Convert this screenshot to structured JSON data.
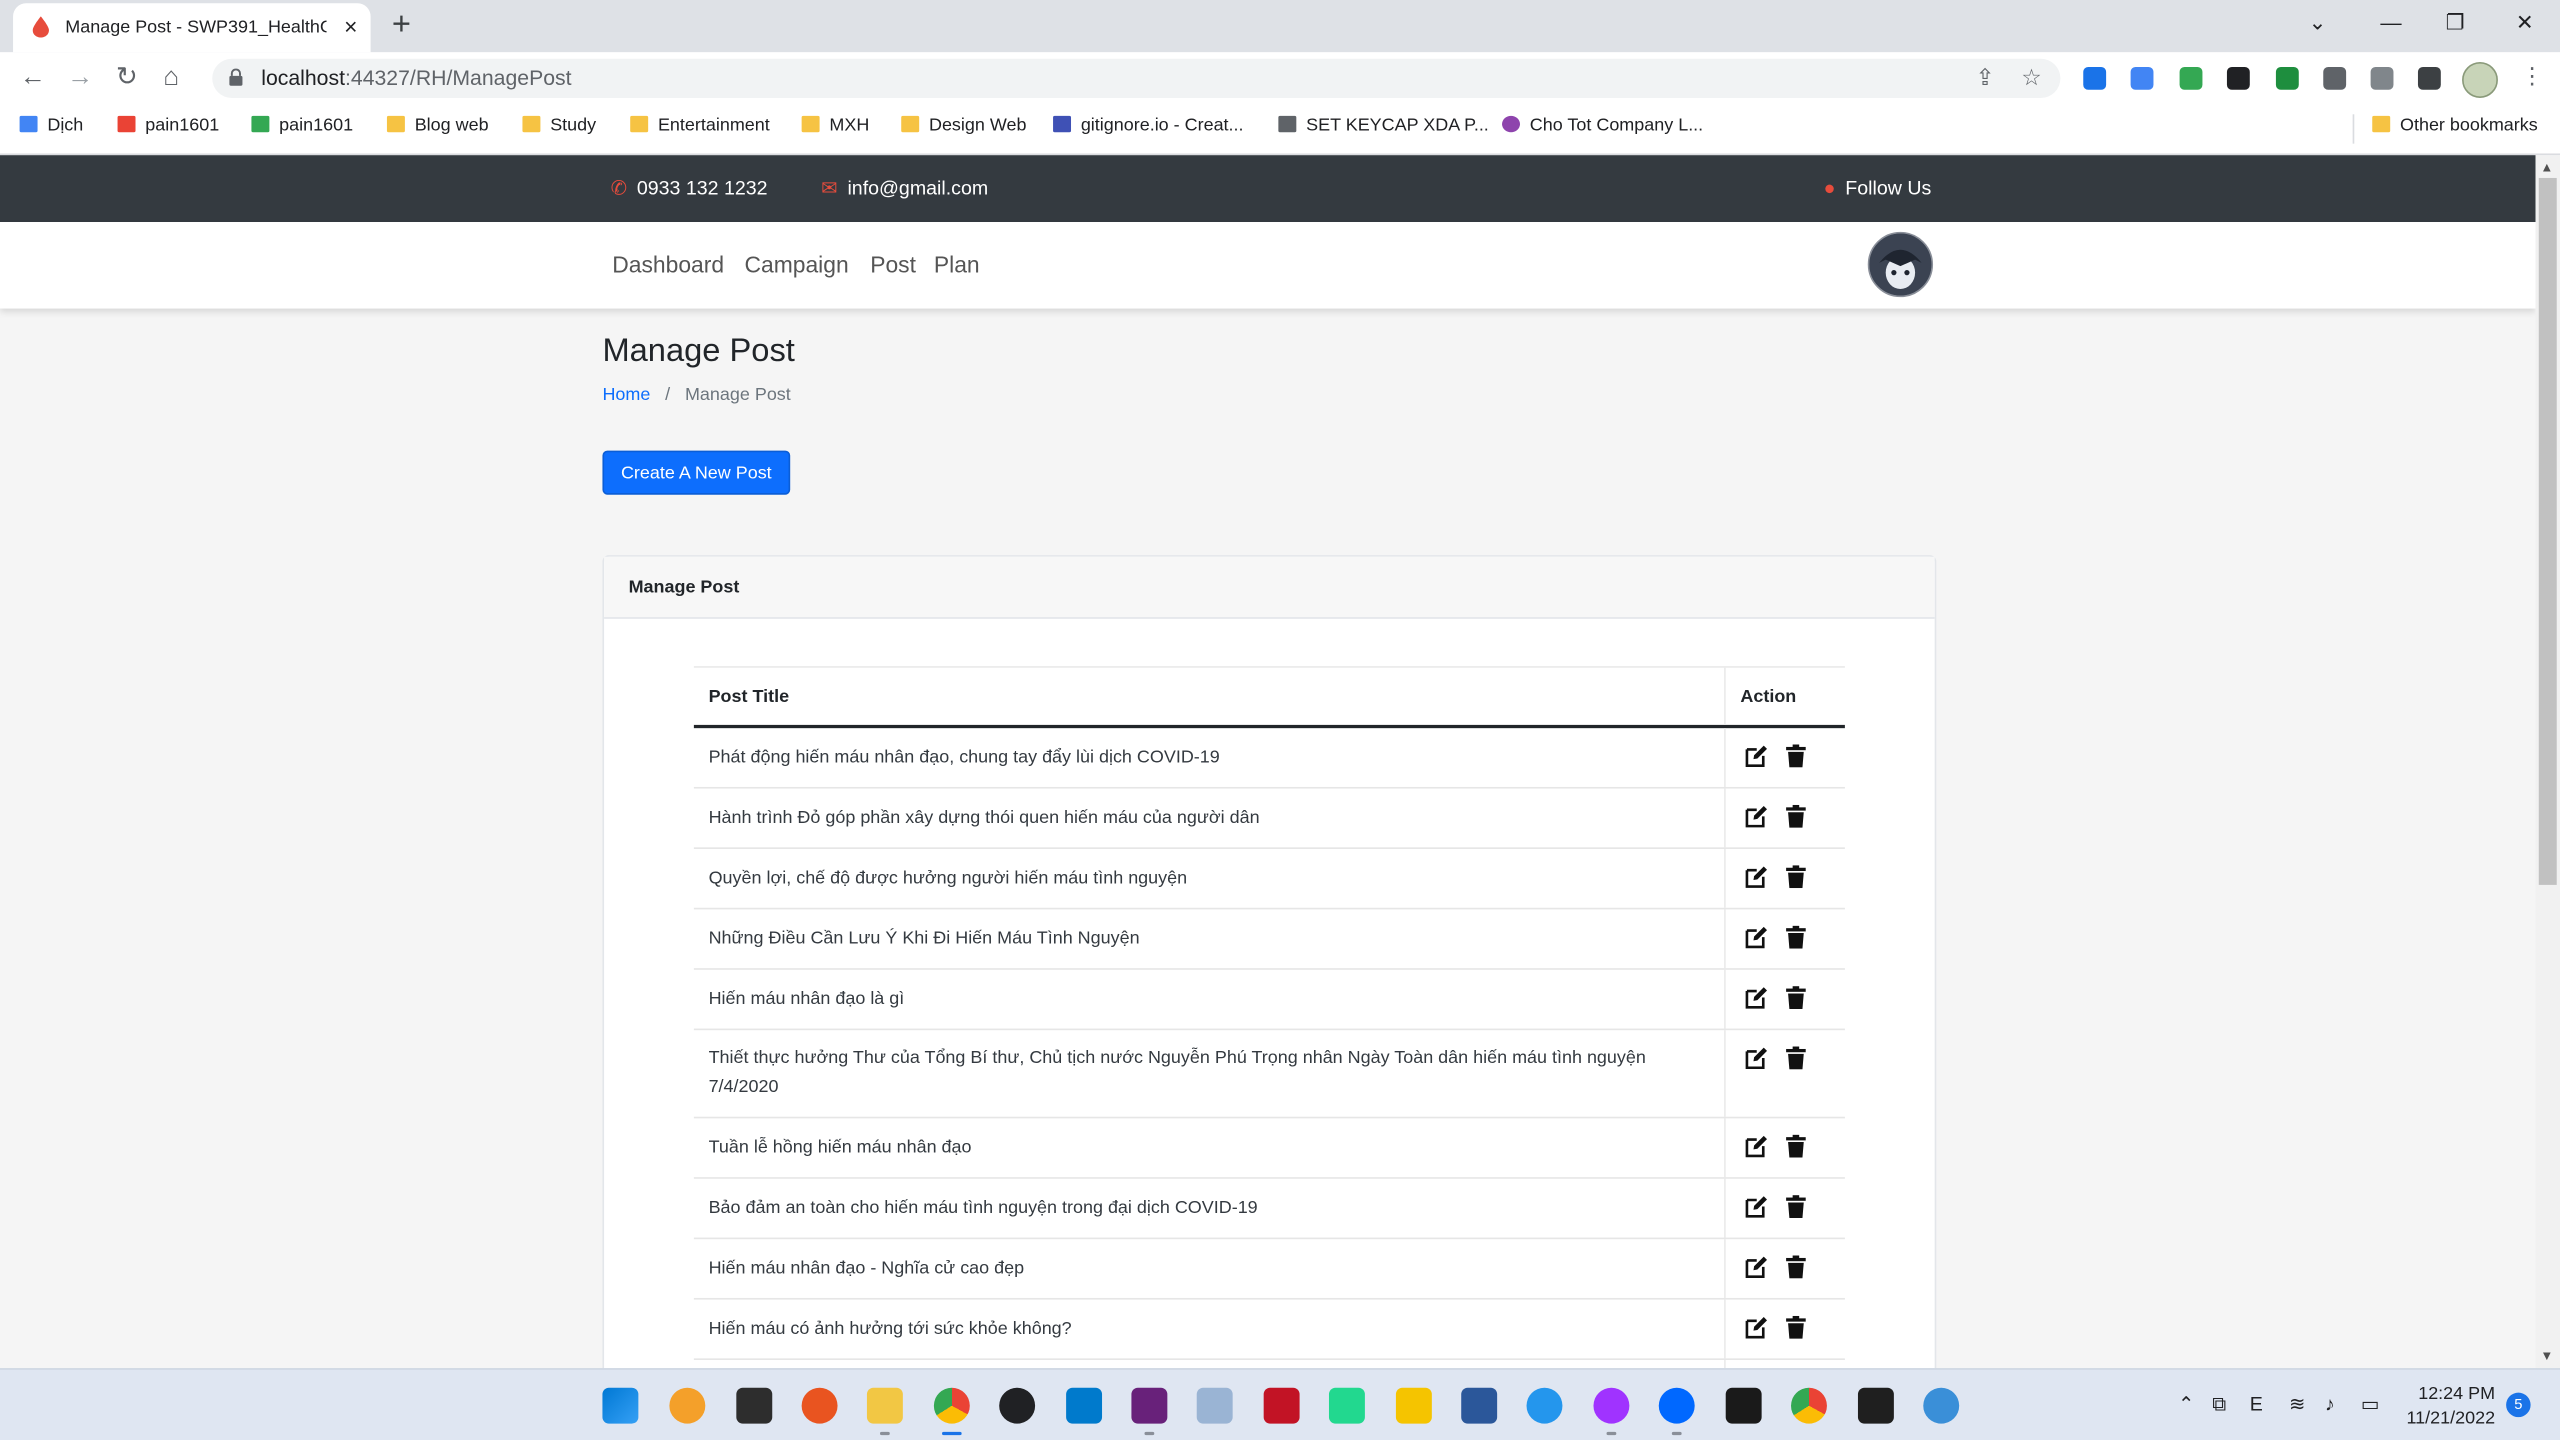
{
  "browser": {
    "tab_title": "Manage Post - SWP391_HealthC",
    "url_host": "localhost",
    "url_path": ":44327/RH/ManagePost",
    "bookmarks": [
      "Dịch",
      "pain1601",
      "pain1601",
      "Blog web",
      "Study",
      "Entertainment",
      "MXH",
      "Design Web",
      "gitignore.io - Creat...",
      "SET KEYCAP XDA P...",
      "Cho Tot Company L...",
      "Other bookmarks"
    ]
  },
  "topbar": {
    "phone": "0933 132 1232",
    "email": "info@gmail.com",
    "follow": "Follow Us"
  },
  "nav": {
    "items": [
      "Dashboard",
      "Campaign",
      "Post",
      "Plan"
    ]
  },
  "page": {
    "title": "Manage Post",
    "breadcrumb_home": "Home",
    "breadcrumb_sep": "/",
    "breadcrumb_current": "Manage Post",
    "create_button": "Create A New Post"
  },
  "card": {
    "title": "Manage Post",
    "columns": [
      "Post Title",
      "Action"
    ],
    "rows": [
      "Phát động hiến máu nhân đạo, chung tay đẩy lùi dịch COVID-19",
      "Hành trình Đỏ góp phần xây dựng thói quen hiến máu của người dân",
      "Quyền lợi, chế độ được hưởng người hiến máu tình nguyện",
      "Những Điều Cần Lưu Ý Khi Đi Hiến Máu Tình Nguyện",
      "Hiến máu nhân đạo là gì",
      "Thiết thực hưởng Thư của Tổng Bí thư, Chủ tịch nước Nguyễn Phú Trọng nhân Ngày Toàn dân hiến máu tình nguyện 7/4/2020",
      "Tuần lễ hồng hiến máu nhân đạo",
      "Bảo đảm an toàn cho hiến máu tình nguyện trong đại dịch COVID-19",
      "Hiến máu nhân đạo - Nghĩa cử cao đẹp",
      "Hiến máu có ảnh hưởng tới sức khỏe không?",
      ""
    ]
  },
  "taskbar": {
    "time": "12:24 PM",
    "date": "11/21/2022",
    "notifications": "5"
  },
  "colors": {
    "primary": "#0d6efd",
    "topbar": "#343a40",
    "accent_red": "#e74c3c"
  }
}
